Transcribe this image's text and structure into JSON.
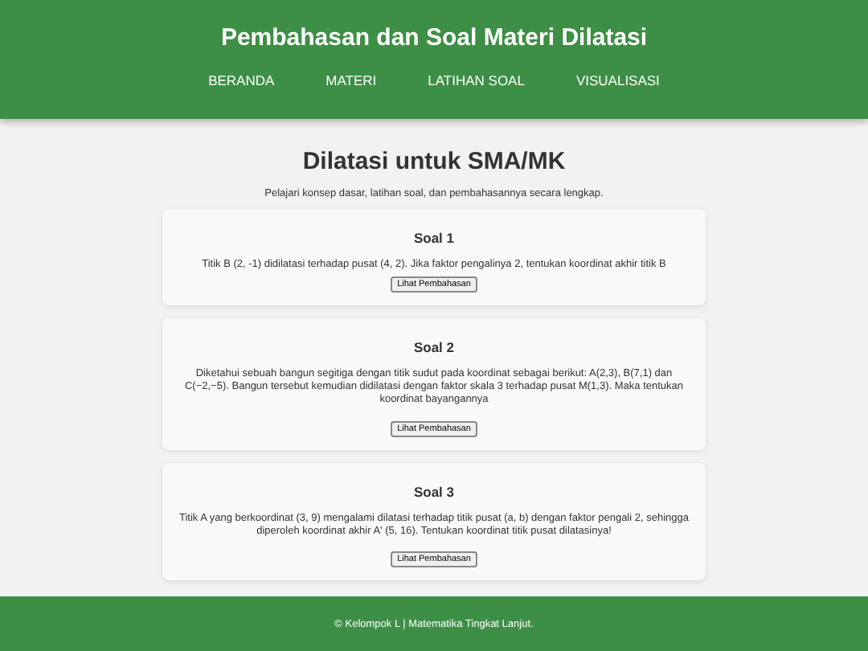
{
  "header": {
    "title": "Pembahasan dan Soal Materi Dilatasi",
    "nav": [
      "BERANDA",
      "MATERI",
      "LATIHAN SOAL",
      "VISUALISASI"
    ]
  },
  "main": {
    "title": "Dilatasi untuk SMA/MK",
    "subtitle": "Pelajari konsep dasar, latihan soal, dan pembahasannya secara lengkap."
  },
  "questions": [
    {
      "title": "Soal 1",
      "text": "Titik B (2, -1) didilatasi terhadap pusat (4, 2). Jika faktor pengalinya 2, tentukan koordinat akhir titik B",
      "button": "Lihat Pembahasan"
    },
    {
      "title": "Soal 2",
      "text": "Diketahui sebuah bangun segitiga dengan titik sudut pada koordinat sebagai berikut: A(2,3), B(7,1) dan C(−2,−5). Bangun tersebut kemudian didilatasi dengan faktor skala 3 terhadap pusat M(1,3). Maka tentukan koordinat bayangannya",
      "button": "Lihat Pembahasan"
    },
    {
      "title": "Soal 3",
      "text": "Titik A yang berkoordinat (3, 9) mengalami dilatasi terhadap titik pusat (a, b) dengan faktor pengali 2, sehingga diperoleh koordinat akhir A' (5, 16). Tentukan koordinat titik pusat dilatasinya!",
      "button": "Lihat Pembahasan"
    }
  ],
  "footer": "© Kelompok L | Matematika Tingkat Lanjut."
}
